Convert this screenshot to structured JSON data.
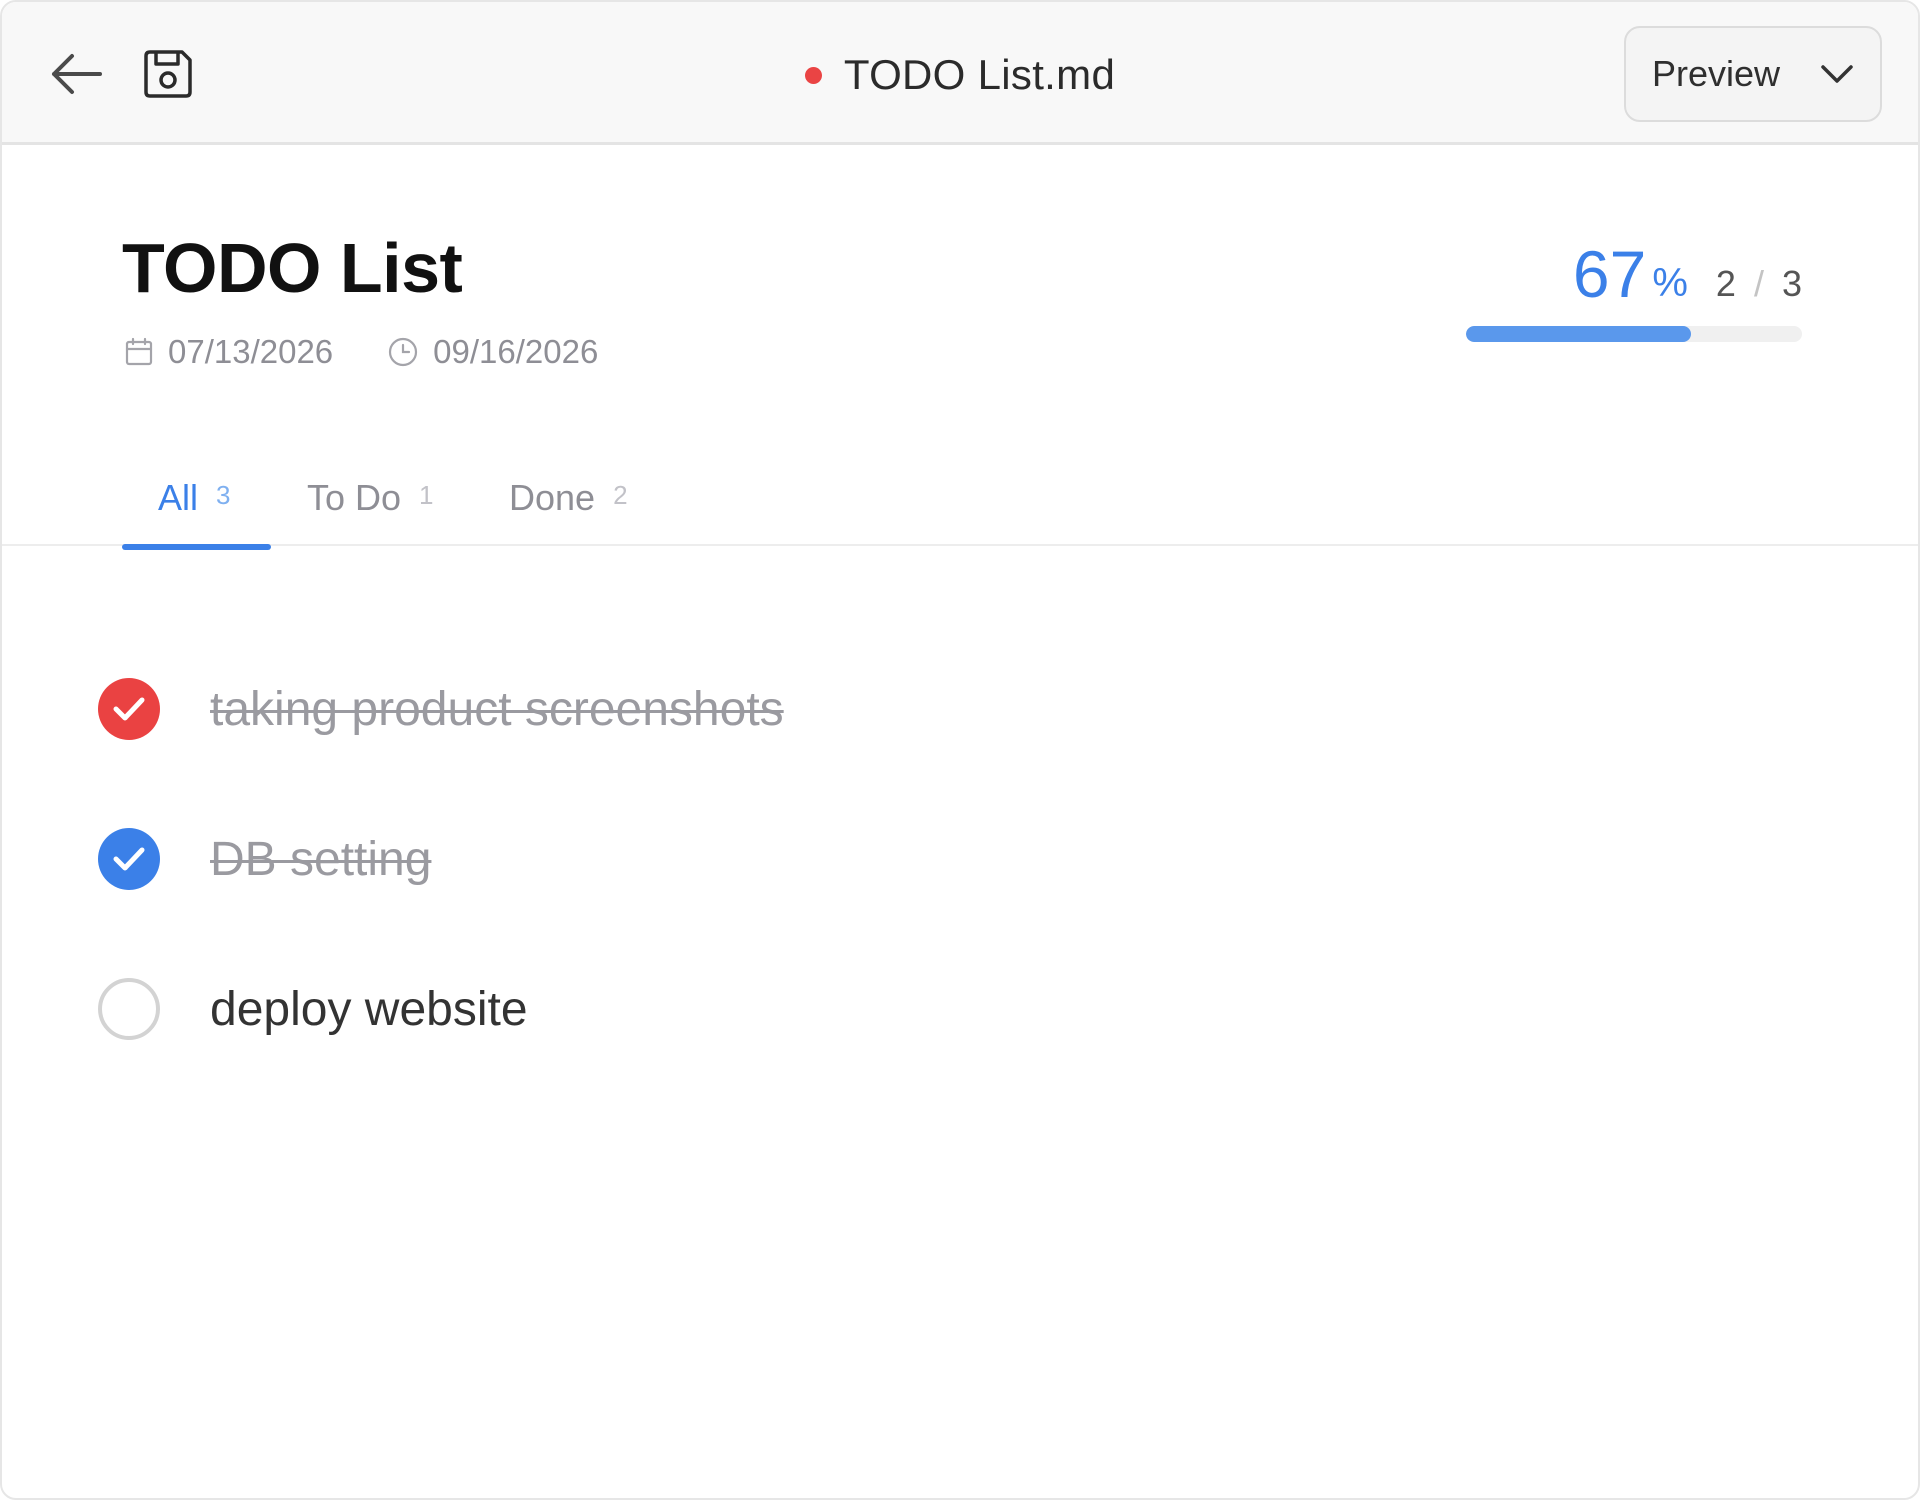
{
  "header": {
    "file_title": "TODO List.md",
    "unsaved_indicator_color": "#ea4444",
    "view_mode": "Preview"
  },
  "document": {
    "title": "TODO List",
    "created_date": "07/13/2026",
    "modified_date": "09/16/2026"
  },
  "progress": {
    "percent": "67",
    "percent_sign": "%",
    "done": "2",
    "separator": "/",
    "total": "3",
    "fraction": 0.67
  },
  "tabs": [
    {
      "label": "All",
      "count": "3",
      "active": true
    },
    {
      "label": "To Do",
      "count": "1",
      "active": false
    },
    {
      "label": "Done",
      "count": "2",
      "active": false
    }
  ],
  "tasks": [
    {
      "text": "taking product screenshots",
      "done": true,
      "check_color": "#ea4242"
    },
    {
      "text": "DB setting",
      "done": true,
      "check_color": "#3b80e8"
    },
    {
      "text": "deploy website",
      "done": false
    }
  ],
  "colors": {
    "accent": "#3b80e8",
    "muted_text": "#8e8e95"
  },
  "icons": {
    "back": "arrow-left-icon",
    "save": "floppy-disk-icon",
    "dropdown": "chevron-down-icon",
    "created": "calendar-icon",
    "modified": "clock-icon",
    "checked": "check-icon"
  }
}
